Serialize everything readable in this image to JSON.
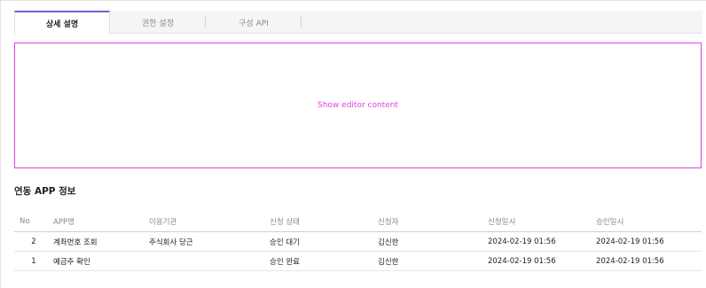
{
  "tabs": [
    {
      "label": "상세 설명",
      "active": true
    },
    {
      "label": "권한 설정",
      "active": false
    },
    {
      "label": "구성 API",
      "active": false
    }
  ],
  "editor": {
    "placeholder_text": "Show editor content"
  },
  "section": {
    "title": "연동 APP 정보"
  },
  "table": {
    "headers": {
      "no": "No",
      "app_name": "APP명",
      "organization": "이용기관",
      "status": "신청 상태",
      "applicant": "신청자",
      "requested_at": "신청일시",
      "approved_at": "승인일시"
    },
    "rows": [
      {
        "no": "2",
        "app_name": "계좌번호 조회",
        "organization": "주식회사 당근",
        "status": "승인 대기",
        "applicant": "김신한",
        "requested_at": "2024-02-19 01:56",
        "approved_at": "2024-02-19 01:56"
      },
      {
        "no": "1",
        "app_name": "예금주 확인",
        "organization": "",
        "status": "승인 완료",
        "applicant": "김신한",
        "requested_at": "2024-02-19 01:56",
        "approved_at": "2024-02-19 01:56"
      }
    ]
  },
  "colors": {
    "accent": "#7b5cd6",
    "editor_border": "#e040e0"
  }
}
